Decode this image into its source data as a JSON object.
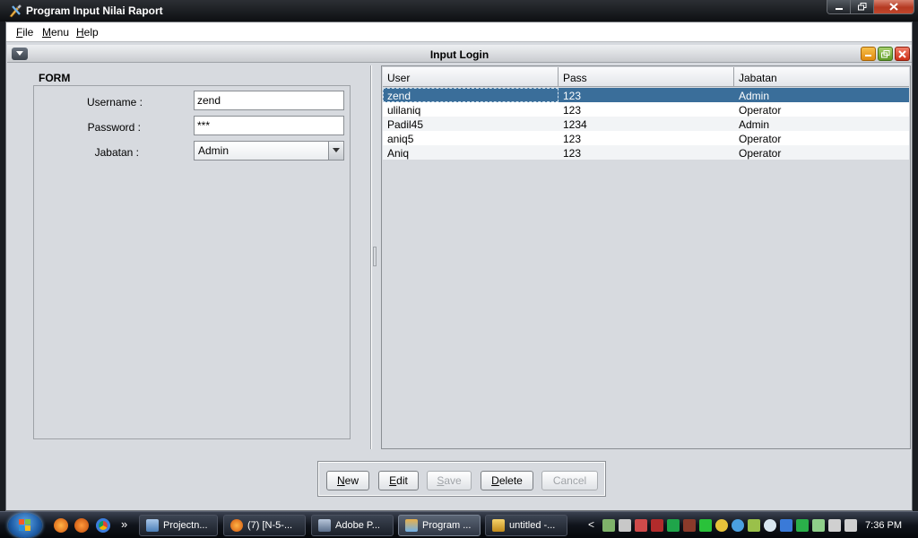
{
  "window": {
    "title": "Program Input Nilai Raport"
  },
  "menubar": {
    "items": [
      "File",
      "Menu",
      "Help"
    ]
  },
  "frame": {
    "title": "Input Login"
  },
  "form": {
    "legend": "FORM",
    "username_label": "Username :",
    "username_value": "zend",
    "password_label": "Password :",
    "password_value": "***",
    "jabatan_label": "Jabatan :",
    "jabatan_value": "Admin"
  },
  "table": {
    "columns": [
      "User",
      "Pass",
      "Jabatan"
    ],
    "rows": [
      [
        "zend",
        "123",
        "Admin"
      ],
      [
        "ulilaniq",
        "123",
        "Operator"
      ],
      [
        "Padil45",
        "1234",
        "Admin"
      ],
      [
        "aniq5",
        "123",
        "Operator"
      ],
      [
        "Aniq",
        "123",
        "Operator"
      ]
    ],
    "selected_row": 0
  },
  "buttons": {
    "new": "New",
    "edit": "Edit",
    "save": "Save",
    "delete": "Delete",
    "cancel": "Cancel"
  },
  "taskbar": {
    "tasks": [
      "Projectn...",
      "(7) [N-5-...",
      "Adobe P...",
      "Program ...",
      "untitled -..."
    ],
    "active_task": 3,
    "overflow": "»",
    "tray_toggle": "<",
    "clock": "7:36 PM"
  },
  "colors": {
    "selection": "#3a6e9a",
    "client_bg": "#d7dadf"
  }
}
